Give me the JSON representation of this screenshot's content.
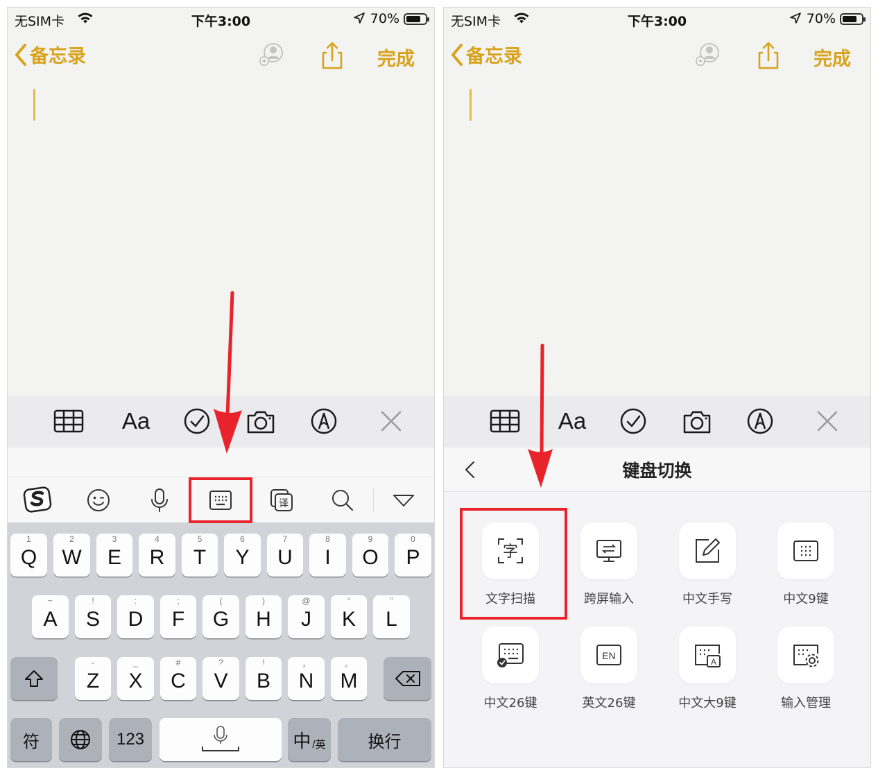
{
  "status": {
    "carrier": "无SIM卡",
    "time": "下午3:00",
    "battery": "70%"
  },
  "nav": {
    "back_label": "备忘录",
    "done_label": "完成"
  },
  "format_bar": {
    "text_style_label": "Aa"
  },
  "keyboard": {
    "row1": [
      {
        "hint": "1",
        "char": "Q"
      },
      {
        "hint": "2",
        "char": "W"
      },
      {
        "hint": "3",
        "char": "E"
      },
      {
        "hint": "4",
        "char": "R"
      },
      {
        "hint": "5",
        "char": "T"
      },
      {
        "hint": "6",
        "char": "Y"
      },
      {
        "hint": "7",
        "char": "U"
      },
      {
        "hint": "8",
        "char": "I"
      },
      {
        "hint": "9",
        "char": "O"
      },
      {
        "hint": "0",
        "char": "P"
      }
    ],
    "row2": [
      {
        "hint": "~",
        "char": "A"
      },
      {
        "hint": "!",
        "char": "S"
      },
      {
        "hint": ":",
        "char": "D"
      },
      {
        "hint": ";",
        "char": "F"
      },
      {
        "hint": "(",
        "char": "G"
      },
      {
        "hint": ")",
        "char": "H"
      },
      {
        "hint": "@",
        "char": "J"
      },
      {
        "hint": "“",
        "char": "K"
      },
      {
        "hint": "”",
        "char": "L"
      }
    ],
    "row3": [
      {
        "hint": "-",
        "char": "Z"
      },
      {
        "hint": "_",
        "char": "X"
      },
      {
        "hint": "#",
        "char": "C"
      },
      {
        "hint": "?",
        "char": "V"
      },
      {
        "hint": "!",
        "char": "B"
      },
      {
        "hint": "，",
        "char": "N"
      },
      {
        "hint": "。",
        "char": "M"
      }
    ],
    "symbol_label": "符",
    "num_label": "123",
    "lang_label": "中",
    "lang_sub_label": "/英",
    "return_label": "换行"
  },
  "switch_panel": {
    "title": "键盘切换",
    "tiles": [
      {
        "label": "文字扫描"
      },
      {
        "label": "跨屏输入"
      },
      {
        "label": "中文手写"
      },
      {
        "label": "中文9键"
      },
      {
        "label": "中文26键"
      },
      {
        "label": "英文26键"
      },
      {
        "label": "中文大9键"
      },
      {
        "label": "输入管理"
      }
    ],
    "en_icon_text": "EN",
    "scan_icon_text": "字",
    "big9_icon_text": "A"
  },
  "colors": {
    "accent": "#d8a31c",
    "highlight": "#e8232b",
    "keyboard_bg": "#d2d3d8",
    "page_bg": "#f3f3f1"
  }
}
